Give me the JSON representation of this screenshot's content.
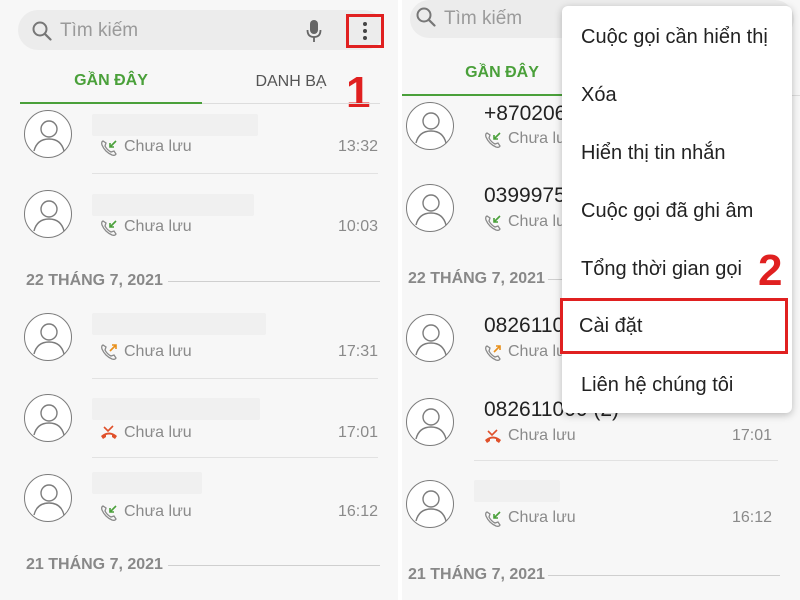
{
  "search": {
    "placeholder": "Tìm kiếm"
  },
  "tabs": {
    "recent": "GẦN ĐÂY",
    "contacts": "DANH BẠ"
  },
  "steps": {
    "one": "1",
    "two": "2"
  },
  "left": {
    "groups": [
      {
        "calls": [
          {
            "name": "",
            "status": "Chưa lưu",
            "time": "13:32",
            "type": "incoming"
          },
          {
            "name": "",
            "status": "Chưa lưu",
            "time": "10:03",
            "type": "incoming"
          }
        ]
      },
      {
        "date": "22 THÁNG 7, 2021",
        "calls": [
          {
            "name": "",
            "status": "Chưa lưu",
            "time": "17:31",
            "type": "outgoing"
          },
          {
            "name": "",
            "status": "Chưa lưu",
            "time": "17:01",
            "type": "missed"
          },
          {
            "name": "",
            "status": "Chưa lưu",
            "time": "16:12",
            "type": "incoming"
          }
        ]
      },
      {
        "date": "21 THÁNG 7, 2021",
        "calls": []
      }
    ]
  },
  "right": {
    "calls": [
      {
        "name": "+870206",
        "status": "Chưa lưu",
        "time": "",
        "type": "incoming"
      },
      {
        "name": "0399975",
        "status": "Chưa lưu",
        "time": "",
        "type": "incoming"
      },
      {
        "name": "0826110",
        "status": "Chưa lưu",
        "time": "",
        "type": "outgoing"
      },
      {
        "name": "082611000 (2)",
        "status": "Chưa lưu",
        "time": "17:01",
        "type": "missed"
      },
      {
        "name": "",
        "status": "Chưa lưu",
        "time": "16:12",
        "type": "incoming"
      }
    ],
    "dates": [
      "22 THÁNG 7, 2021",
      "21 THÁNG 7, 2021"
    ]
  },
  "menu": {
    "items": [
      "Cuộc gọi cần hiển thị",
      "Xóa",
      "Hiển thị tin nhắn",
      "Cuộc gọi đã ghi âm",
      "Tổng thời gian gọi",
      "Cài đặt",
      "Liên hệ chúng tôi"
    ]
  },
  "colors": {
    "accent": "#4aa03a",
    "highlight": "#e02020",
    "incoming": "#4aa03a",
    "outgoing": "#e8901c",
    "missed": "#e0502a"
  }
}
